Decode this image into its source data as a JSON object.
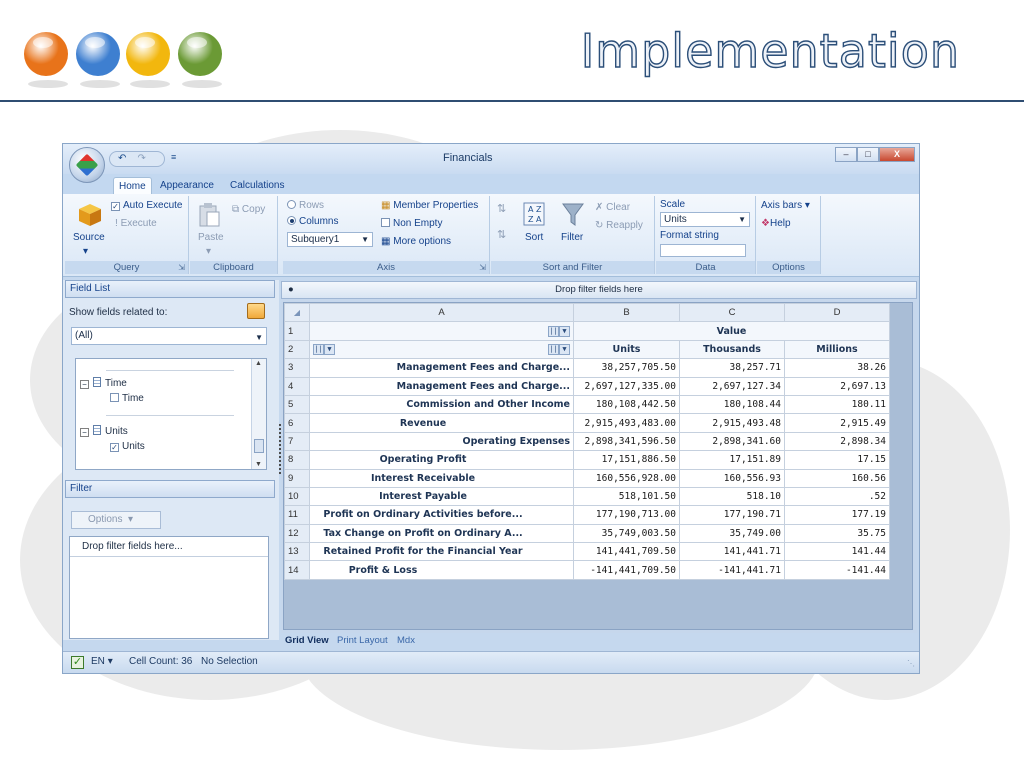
{
  "slide": {
    "title": "Implementation",
    "ball_colors": [
      "#e8731a",
      "#3e7fd0",
      "#f2b70e",
      "#6b9a35"
    ]
  },
  "window": {
    "title": "Financials",
    "quick_access": {
      "undo": "↶",
      "redo": "↷",
      "customize": "≡"
    },
    "controls": {
      "minimize": "–",
      "maximize": "□",
      "close": "X"
    }
  },
  "ribbon": {
    "tabs": [
      {
        "label": "Home",
        "active": true
      },
      {
        "label": "Appearance",
        "active": false
      },
      {
        "label": "Calculations",
        "active": false
      }
    ],
    "query": {
      "source_label": "Source",
      "source_arrow": "▾",
      "auto_execute_label": "Auto Execute",
      "auto_execute_checked": true,
      "execute_label": "Execute",
      "group_label": "Query"
    },
    "clipboard": {
      "paste_label": "Paste",
      "paste_arrow": "▾",
      "copy_label": "Copy",
      "group_label": "Clipboard"
    },
    "axis": {
      "rows_label": "Rows",
      "columns_label": "Columns",
      "selected_axis": "Columns",
      "subquery_value": "Subquery1",
      "member_properties_label": "Member Properties",
      "non_empty_label": "Non Empty",
      "more_options_label": "More options",
      "group_label": "Axis"
    },
    "sort_filter": {
      "sort_label": "Sort",
      "filter_label": "Filter",
      "clear_label": "Clear",
      "reapply_label": "Reapply",
      "group_label": "Sort and Filter"
    },
    "data": {
      "scale_label": "Scale",
      "scale_value": "Units",
      "format_string_label": "Format string",
      "format_string_value": "",
      "group_label": "Data"
    },
    "options": {
      "axis_bars_label": "Axis bars",
      "axis_bars_arrow": "▾",
      "help_label": "Help",
      "group_label": "Options"
    }
  },
  "field_list": {
    "header": "Field List",
    "show_related_label": "Show fields related to:",
    "related_value": "(All)",
    "tree": [
      {
        "kind": "group",
        "label": "Time"
      },
      {
        "kind": "field",
        "label": "Time",
        "checked": false
      },
      {
        "kind": "group",
        "label": "Units"
      },
      {
        "kind": "field",
        "label": "Units",
        "checked": true
      }
    ]
  },
  "filter_panel": {
    "header": "Filter",
    "options_label": "Options",
    "drop_text": "Drop filter fields here..."
  },
  "grid": {
    "drop_bar_text": "Drop filter fields here",
    "drop_bar_bullet": "●",
    "column_letters": [
      "A",
      "B",
      "C",
      "D"
    ],
    "value_header": "Value",
    "scale_headers": [
      "Units",
      "Thousands",
      "Millions"
    ],
    "rows": [
      {
        "n": "3",
        "label": "Management Fees and Charge...",
        "indent": 2,
        "values": [
          "38,257,705.50",
          "38,257.71",
          "38.26"
        ]
      },
      {
        "n": "4",
        "label": "Management Fees and Charge...",
        "indent": 2,
        "values": [
          "2,697,127,335.00",
          "2,697,127.34",
          "2,697.13"
        ]
      },
      {
        "n": "5",
        "label": "Commission and Other Income",
        "indent": 2,
        "values": [
          "180,108,442.50",
          "180,108.44",
          "180.11"
        ]
      },
      {
        "n": "6",
        "label": "Revenue",
        "indent": 1,
        "values": [
          "2,915,493,483.00",
          "2,915,493.48",
          "2,915.49"
        ]
      },
      {
        "n": "7",
        "label": "Operating Expenses",
        "indent": 2,
        "values": [
          "2,898,341,596.50",
          "2,898,341.60",
          "2,898.34"
        ]
      },
      {
        "n": "8",
        "label": "Operating Profit",
        "indent": 1,
        "values": [
          "17,151,886.50",
          "17,151.89",
          "17.15"
        ]
      },
      {
        "n": "9",
        "label": "Interest Receivable",
        "indent": 1,
        "values": [
          "160,556,928.00",
          "160,556.93",
          "160.56"
        ]
      },
      {
        "n": "10",
        "label": "Interest Payable",
        "indent": 1,
        "values": [
          "518,101.50",
          "518.10",
          ".52"
        ]
      },
      {
        "n": "11",
        "label": "Profit on Ordinary Activities before...",
        "indent": 1,
        "values": [
          "177,190,713.00",
          "177,190.71",
          "177.19"
        ]
      },
      {
        "n": "12",
        "label": "Tax Change on Profit on Ordinary A...",
        "indent": 1,
        "values": [
          "35,749,003.50",
          "35,749.00",
          "35.75"
        ]
      },
      {
        "n": "13",
        "label": "Retained Profit for the Financial Year",
        "indent": 1,
        "values": [
          "141,441,709.50",
          "141,441.71",
          "141.44"
        ]
      },
      {
        "n": "14",
        "label": "Profit & Loss",
        "indent": 0,
        "values": [
          "-141,441,709.50",
          "-141,441.71",
          "-141.44"
        ]
      }
    ]
  },
  "sheet_tabs": [
    {
      "label": "Grid View",
      "active": true
    },
    {
      "label": "Print Layout",
      "active": false
    },
    {
      "label": "Mdx",
      "active": false
    }
  ],
  "status": {
    "language": "EN",
    "language_arrow": "▾",
    "cell_count": "Cell Count: 36",
    "selection": "No Selection"
  }
}
